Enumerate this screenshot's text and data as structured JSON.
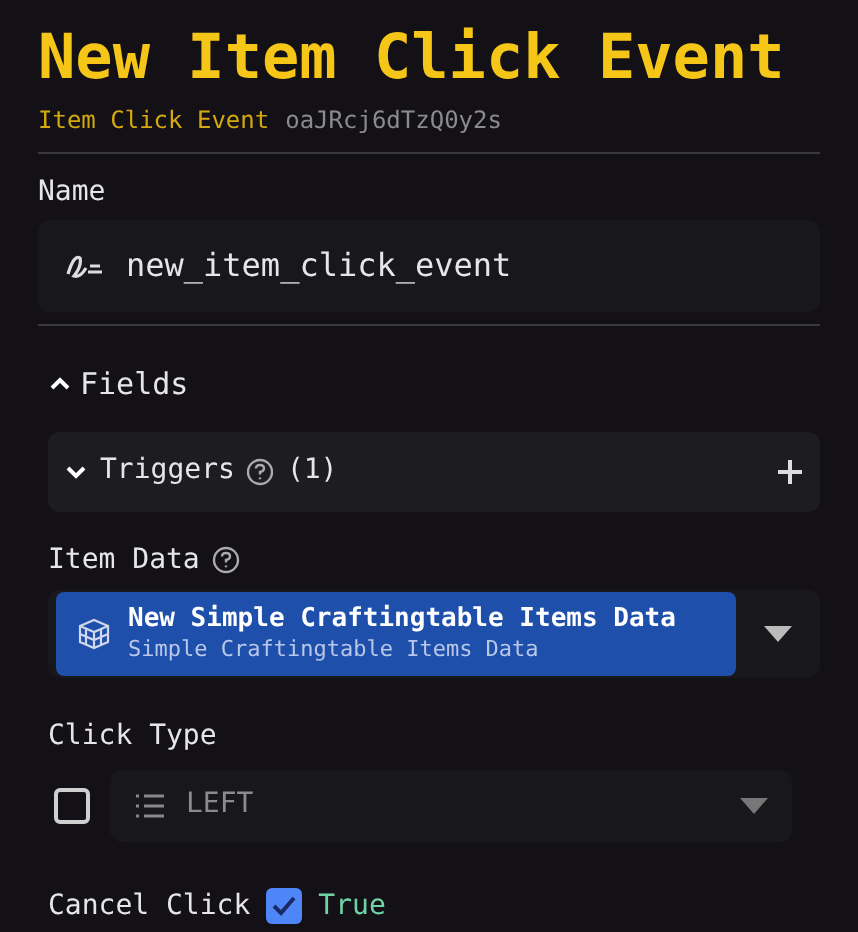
{
  "title": "New Item Click Event",
  "subtitle": {
    "type": "Item Click Event",
    "id": "oaJRcj6dTzQ0y2s"
  },
  "name_field": {
    "label": "Name",
    "value": "new_item_click_event"
  },
  "fields_section": {
    "label": "Fields",
    "expanded": true
  },
  "triggers": {
    "label": "Triggers",
    "count": "(1)",
    "expanded": false
  },
  "item_data": {
    "label": "Item Data",
    "value": {
      "title": "New Simple Craftingtable Items Data",
      "subtitle": "Simple Craftingtable Items Data"
    }
  },
  "click_type": {
    "label": "Click Type",
    "checked": false,
    "value": "LEFT"
  },
  "cancel_click": {
    "label": "Cancel Click",
    "checked": true,
    "value": "True"
  }
}
